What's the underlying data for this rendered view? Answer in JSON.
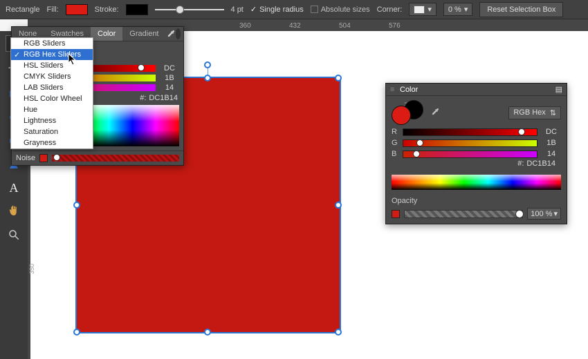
{
  "context_bar": {
    "object_type": "Rectangle",
    "fill_label": "Fill:",
    "fill_color": "#DC1B14",
    "stroke_label": "Stroke:",
    "stroke_color": "#000000",
    "stroke_width": "4 pt",
    "single_radius_label": "Single radius",
    "single_radius_checked": true,
    "absolute_sizes_label": "Absolute sizes",
    "absolute_sizes_checked": false,
    "corner_label": "Corner:",
    "corner_value": "0 %",
    "reset_label": "Reset Selection Box"
  },
  "ruler": {
    "ticks": [
      360,
      432,
      504,
      576
    ]
  },
  "vruler": {
    "tick_350": "350"
  },
  "popover": {
    "tabs": {
      "none": "None",
      "swatches": "Swatches",
      "color": "Color",
      "gradient": "Gradient"
    },
    "active_tab": "Color",
    "sliders": {
      "r": {
        "label": "",
        "value": "DC"
      },
      "g": {
        "label": "",
        "value": "1B"
      },
      "b": {
        "label": "",
        "value": "14"
      }
    },
    "hex_prefix": "#:",
    "hex_value": "DC1B14",
    "noise_label": "Noise",
    "dropdown_opener_icon": "cog-icon"
  },
  "slider_menu": {
    "items": [
      "RGB Sliders",
      "RGB Hex Sliders",
      "HSL Sliders",
      "CMYK Sliders",
      "LAB Sliders",
      "HSL Color Wheel",
      "Hue",
      "Lightness",
      "Saturation",
      "Grayness"
    ],
    "selected_index": 1
  },
  "color_panel": {
    "title": "Color",
    "model_label": "RGB Hex",
    "fill_color": "#DC1B14",
    "stroke_color": "#000000",
    "channels": {
      "r": {
        "label": "R",
        "value": "DC"
      },
      "g": {
        "label": "G",
        "value": "1B"
      },
      "b": {
        "label": "B",
        "value": "14"
      }
    },
    "hex_prefix": "#:",
    "hex_value": "DC1B14",
    "opacity_label": "Opacity",
    "opacity_value": "100 %"
  },
  "tools": {
    "crop": "crop-icon",
    "rect": "rectangle-shape-icon",
    "ellipse": "ellipse-shape-icon",
    "rounded": "rounded-rectangle-icon",
    "triangle": "triangle-shape-icon",
    "text": "text-tool-icon",
    "hand": "hand-tool-icon",
    "zoom": "zoom-tool-icon"
  }
}
